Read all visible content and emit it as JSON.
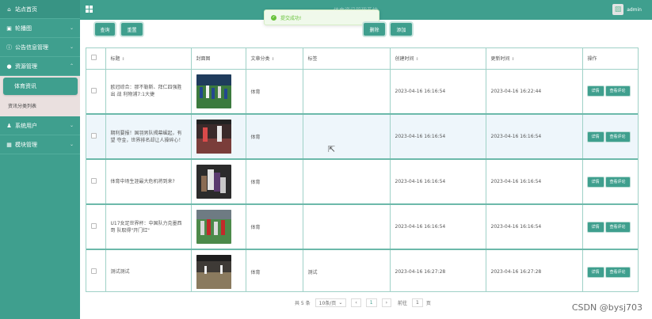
{
  "header": {
    "system_title": "体育资讯管理系统",
    "username": "admin"
  },
  "sidebar": {
    "home": "站点首页",
    "items": [
      {
        "label": "轮播图",
        "icon": "image-icon"
      },
      {
        "label": "公告信息管理",
        "icon": "info-icon"
      },
      {
        "label": "资源管理",
        "icon": "resource-icon"
      }
    ],
    "sub_items": [
      "体育资讯",
      "资讯分类列表"
    ],
    "items_after": [
      {
        "label": "系统用户",
        "icon": "user-icon"
      },
      {
        "label": "模块管理",
        "icon": "module-icon"
      }
    ]
  },
  "toast": {
    "message": "提交成功!"
  },
  "toolbar": {
    "query": "查询",
    "reset": "重置",
    "delete": "删除",
    "add": "添加"
  },
  "table": {
    "columns": [
      "标题",
      "封面图",
      "文章分类",
      "标签",
      "创建时间",
      "更新时间",
      "操作"
    ],
    "sortable": [
      true,
      false,
      true,
      false,
      true,
      true,
      false
    ],
    "rows": [
      {
        "title": "欧冠综合：那不勒斯、拜仁四强胜出 战 利物浦7:1大捷",
        "category": "体育",
        "tag": "",
        "created": "2023-04-16 16:16:54",
        "updated": "2023-04-16 16:22:44"
      },
      {
        "title": "期利要报！国羽男队揭幕崛起，有望 夺金，世界排名却让人操碎心！",
        "category": "体育",
        "tag": "",
        "created": "2023-04-16 16:16:54",
        "updated": "2023-04-16 16:16:54"
      },
      {
        "title": "体育中场生涯最大危机将到来?",
        "category": "体育",
        "tag": "",
        "created": "2023-04-16 16:16:54",
        "updated": "2023-04-16 16:16:54"
      },
      {
        "title": "U17女足世界杯：中国队力克墨西哥 队取得\"开门红\"",
        "category": "体育",
        "tag": "",
        "created": "2023-04-16 16:16:54",
        "updated": "2023-04-16 16:16:54"
      },
      {
        "title": "测试测试",
        "category": "体育",
        "tag": "测试",
        "created": "2023-04-16 16:27:28",
        "updated": "2023-04-16 16:27:28"
      }
    ],
    "actions": {
      "detail": "详情",
      "comments": "查看评论"
    }
  },
  "pagination": {
    "total": "共 5 条",
    "page_size": "10条/页",
    "prev": "‹",
    "current": "1",
    "next": "›",
    "goto": "前往",
    "goto_value": "1",
    "page_unit": "页"
  },
  "watermark": "CSDN @bysj703"
}
